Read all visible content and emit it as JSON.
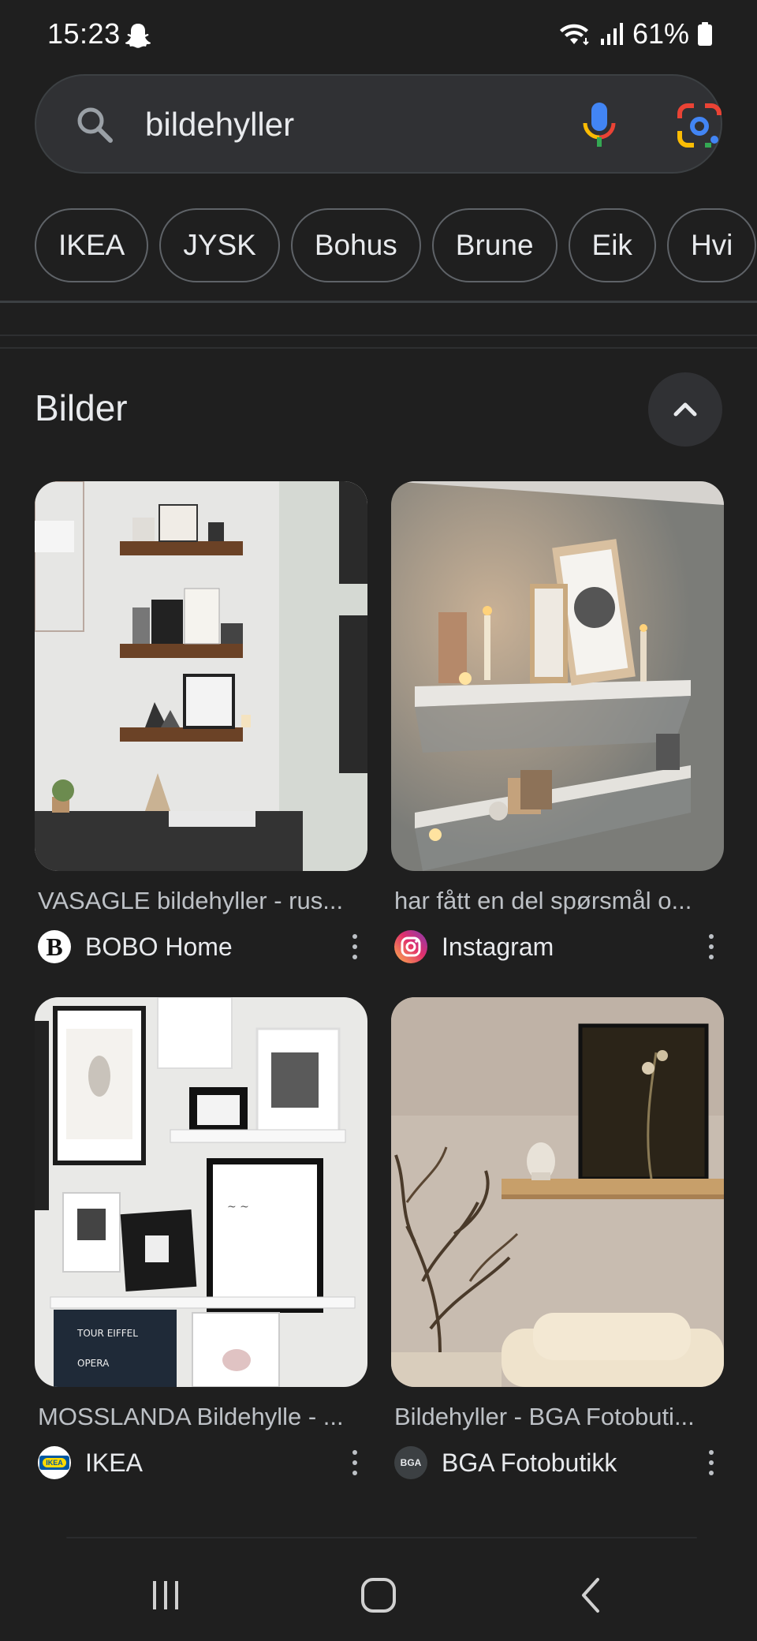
{
  "status_bar": {
    "time": "15:23",
    "battery": "61%",
    "icons": [
      "snapchat-ghost-icon",
      "wifi-icon",
      "signal-icon",
      "battery-icon"
    ]
  },
  "search": {
    "query": "bildehyller",
    "icons": [
      "search-icon",
      "mic-icon",
      "google-lens-icon"
    ]
  },
  "chips": [
    "IKEA",
    "JYSK",
    "Bohus",
    "Brune",
    "Eik",
    "Hvi"
  ],
  "section": {
    "title": "Bilder"
  },
  "results": [
    {
      "title": "VASAGLE bildehyller - rus...",
      "source": "BOBO Home",
      "logo_letter": "B"
    },
    {
      "title": "har fått en del spørsmål o...",
      "source": "Instagram"
    },
    {
      "title": "MOSSLANDA Bildehylle - ...",
      "source": "IKEA",
      "logo_letter": "IKEA"
    },
    {
      "title": "Bildehyller - BGA Fotobuti...",
      "source": "BGA Fotobutikk",
      "logo_letter": "BGA"
    }
  ],
  "colors": {
    "background": "#1f1f1f",
    "surface": "#303134",
    "text": "#e8eaed",
    "secondary_text": "#bdc1c6"
  }
}
